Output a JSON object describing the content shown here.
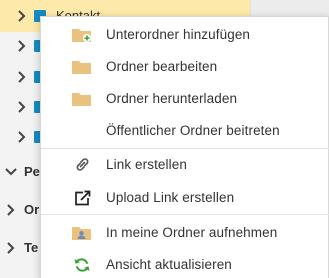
{
  "tree": {
    "selected_label": "Kontakt...",
    "sections": [
      "Pe",
      "Or",
      "Te"
    ]
  },
  "menu": {
    "items": [
      {
        "label": "Unterordner hinzufügen",
        "icon": "folder-add-icon"
      },
      {
        "label": "Ordner bearbeiten",
        "icon": "folder-icon"
      },
      {
        "label": "Ordner herunterladen",
        "icon": "folder-icon"
      },
      {
        "label": "Öffentlicher Ordner beitreten",
        "icon": ""
      },
      {
        "label": "Link erstellen",
        "icon": "link-icon"
      },
      {
        "label": "Upload Link erstellen",
        "icon": "external-link-icon"
      },
      {
        "label": "In meine Ordner aufnehmen",
        "icon": "user-folder-icon"
      },
      {
        "label": "Ansicht aktualisieren",
        "icon": "refresh-icon"
      }
    ]
  },
  "colors": {
    "selected_row": "#fde9a9",
    "folder_tan": "#e9c27f",
    "tree_folder_blue": "#138cc2",
    "refresh_green": "#3aa03a"
  }
}
